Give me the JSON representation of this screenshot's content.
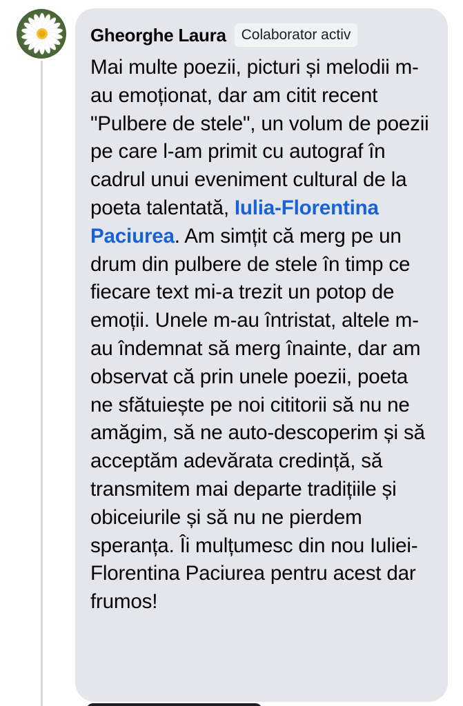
{
  "comment": {
    "author": "Gheorghe Laura",
    "badge": "Colaborator activ",
    "text_part1": "Mai multe poezii, picturi și melodii m-au emoționat, dar am citit recent \"Pulbere de stele\", un volum de poezii pe care l-am primit cu autograf în cadrul unui eveniment cultural de la poeta talentată, ",
    "mention": "Iulia-Florentina Paciurea",
    "text_part2": ". Am simțit că merg pe un drum din pulbere de stele în timp ce fiecare text mi-a trezit un potop de emoții. Unele m-au întristat, altele m-au îndemnat să merg înainte, dar am observat că prin unele poezii, poeta ne sfătuiește pe noi cititorii să nu ne amăgim, să ne auto-descoperim și să acceptăm adevărata credință, să transmitem mai departe tradițiile și obiceiurile și să nu ne pierdem speranța. Îi mulțumesc din nou Iuliei-Florentina Paciurea pentru acest dar frumos!"
  },
  "avatar": {
    "icon": "daisy-flower-icon"
  },
  "colors": {
    "bubble": "#e4e6eb",
    "mention": "#1662d6",
    "text": "#050505",
    "thread_line": "#d7d9dd"
  }
}
